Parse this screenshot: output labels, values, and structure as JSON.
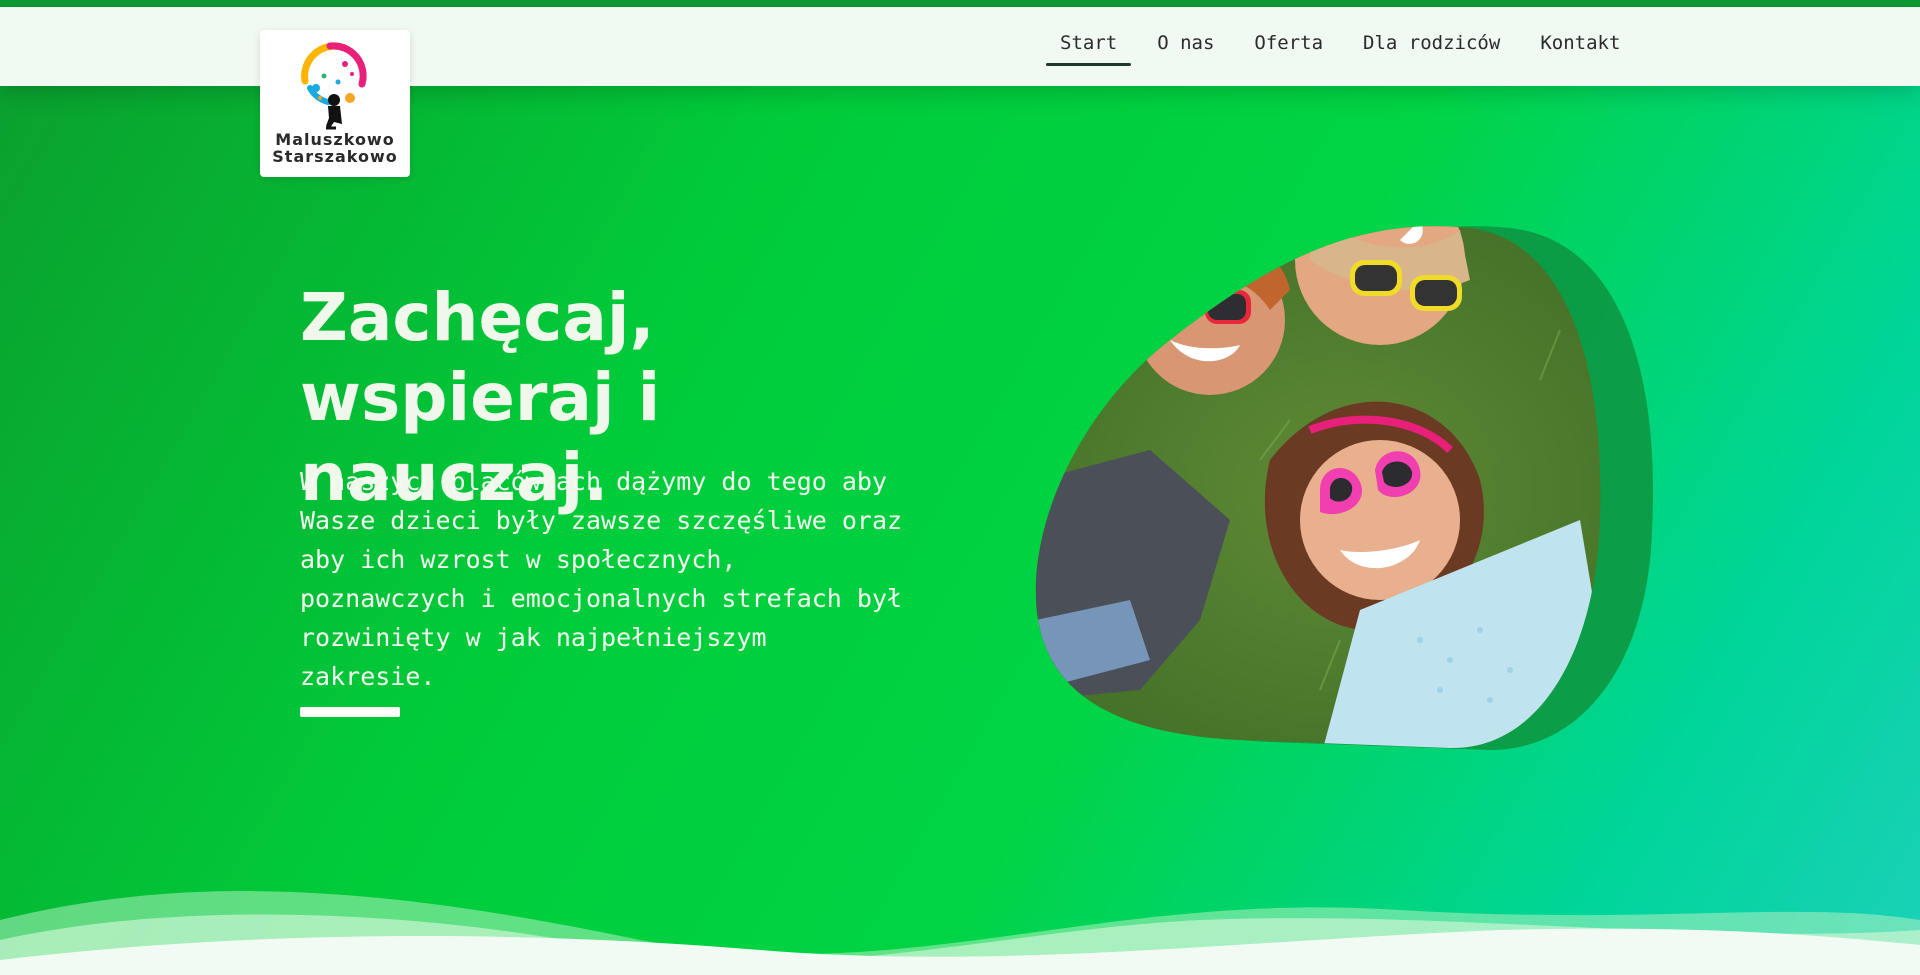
{
  "brand": {
    "name_line1": "Maluszkowo",
    "name_line2": "Starszakowo"
  },
  "nav": {
    "items": [
      {
        "label": "Start",
        "active": true
      },
      {
        "label": "O nas",
        "active": false
      },
      {
        "label": "Oferta",
        "active": false
      },
      {
        "label": "Dla rodziców",
        "active": false
      },
      {
        "label": "Kontakt",
        "active": false
      }
    ]
  },
  "hero": {
    "title_line1": "Zachęcaj, wspieraj i",
    "title_line2": "nauczaj.",
    "text_lines": [
      "W naszych placówkach dążymy do tego aby",
      "Wasze dzieci były zawsze szczęśliwe oraz",
      "aby ich wzrost w społecznych,",
      "poznawczych i emocjonalnych strefach był",
      "rozwinięty w jak najpełniejszym",
      "zakresie."
    ]
  },
  "colors": {
    "gradient_start": "#0b9e2d",
    "gradient_mid": "#00d445",
    "gradient_end": "#1bd1b8",
    "navbar_bg": "#f1faf2",
    "blob_shadow": "#0c9a45"
  },
  "icons": [
    "logo-child-balloons-icon"
  ]
}
